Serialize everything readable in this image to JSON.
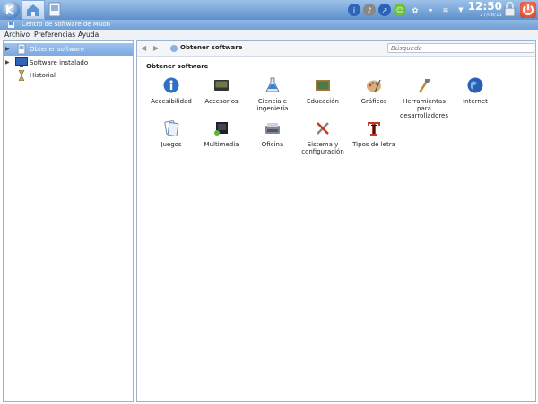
{
  "window": {
    "title": "Centro de software de Muon"
  },
  "clock": {
    "time": "12:50",
    "date": "27/08/11"
  },
  "menu": [
    "Archivo",
    "Preferencias",
    "Ayuda"
  ],
  "sidebar": {
    "items": [
      {
        "label": "Obtener software",
        "selected": true
      },
      {
        "label": "Software instalado",
        "selected": false
      },
      {
        "label": "Historial",
        "selected": false
      }
    ]
  },
  "toolbar": {
    "breadcrumb": "Obtener software",
    "search_placeholder": "Búsqueda"
  },
  "main": {
    "section_title": "Obtener software",
    "categories": [
      {
        "label": "Accesibilidad",
        "icon": "accessibility-icon"
      },
      {
        "label": "Accesorios",
        "icon": "accessories-icon"
      },
      {
        "label": "Ciencia e ingeniería",
        "icon": "science-icon"
      },
      {
        "label": "Educación",
        "icon": "education-icon"
      },
      {
        "label": "Gráficos",
        "icon": "graphics-icon"
      },
      {
        "label": "Herramientas para desarrolladores",
        "icon": "developer-tools-icon"
      },
      {
        "label": "Internet",
        "icon": "internet-icon"
      },
      {
        "label": "Juegos",
        "icon": "games-icon"
      },
      {
        "label": "Multimedia",
        "icon": "multimedia-icon"
      },
      {
        "label": "Oficina",
        "icon": "office-icon"
      },
      {
        "label": "Sistema y configuración",
        "icon": "system-icon"
      },
      {
        "label": "Tipos de letra",
        "icon": "fonts-icon"
      }
    ]
  }
}
